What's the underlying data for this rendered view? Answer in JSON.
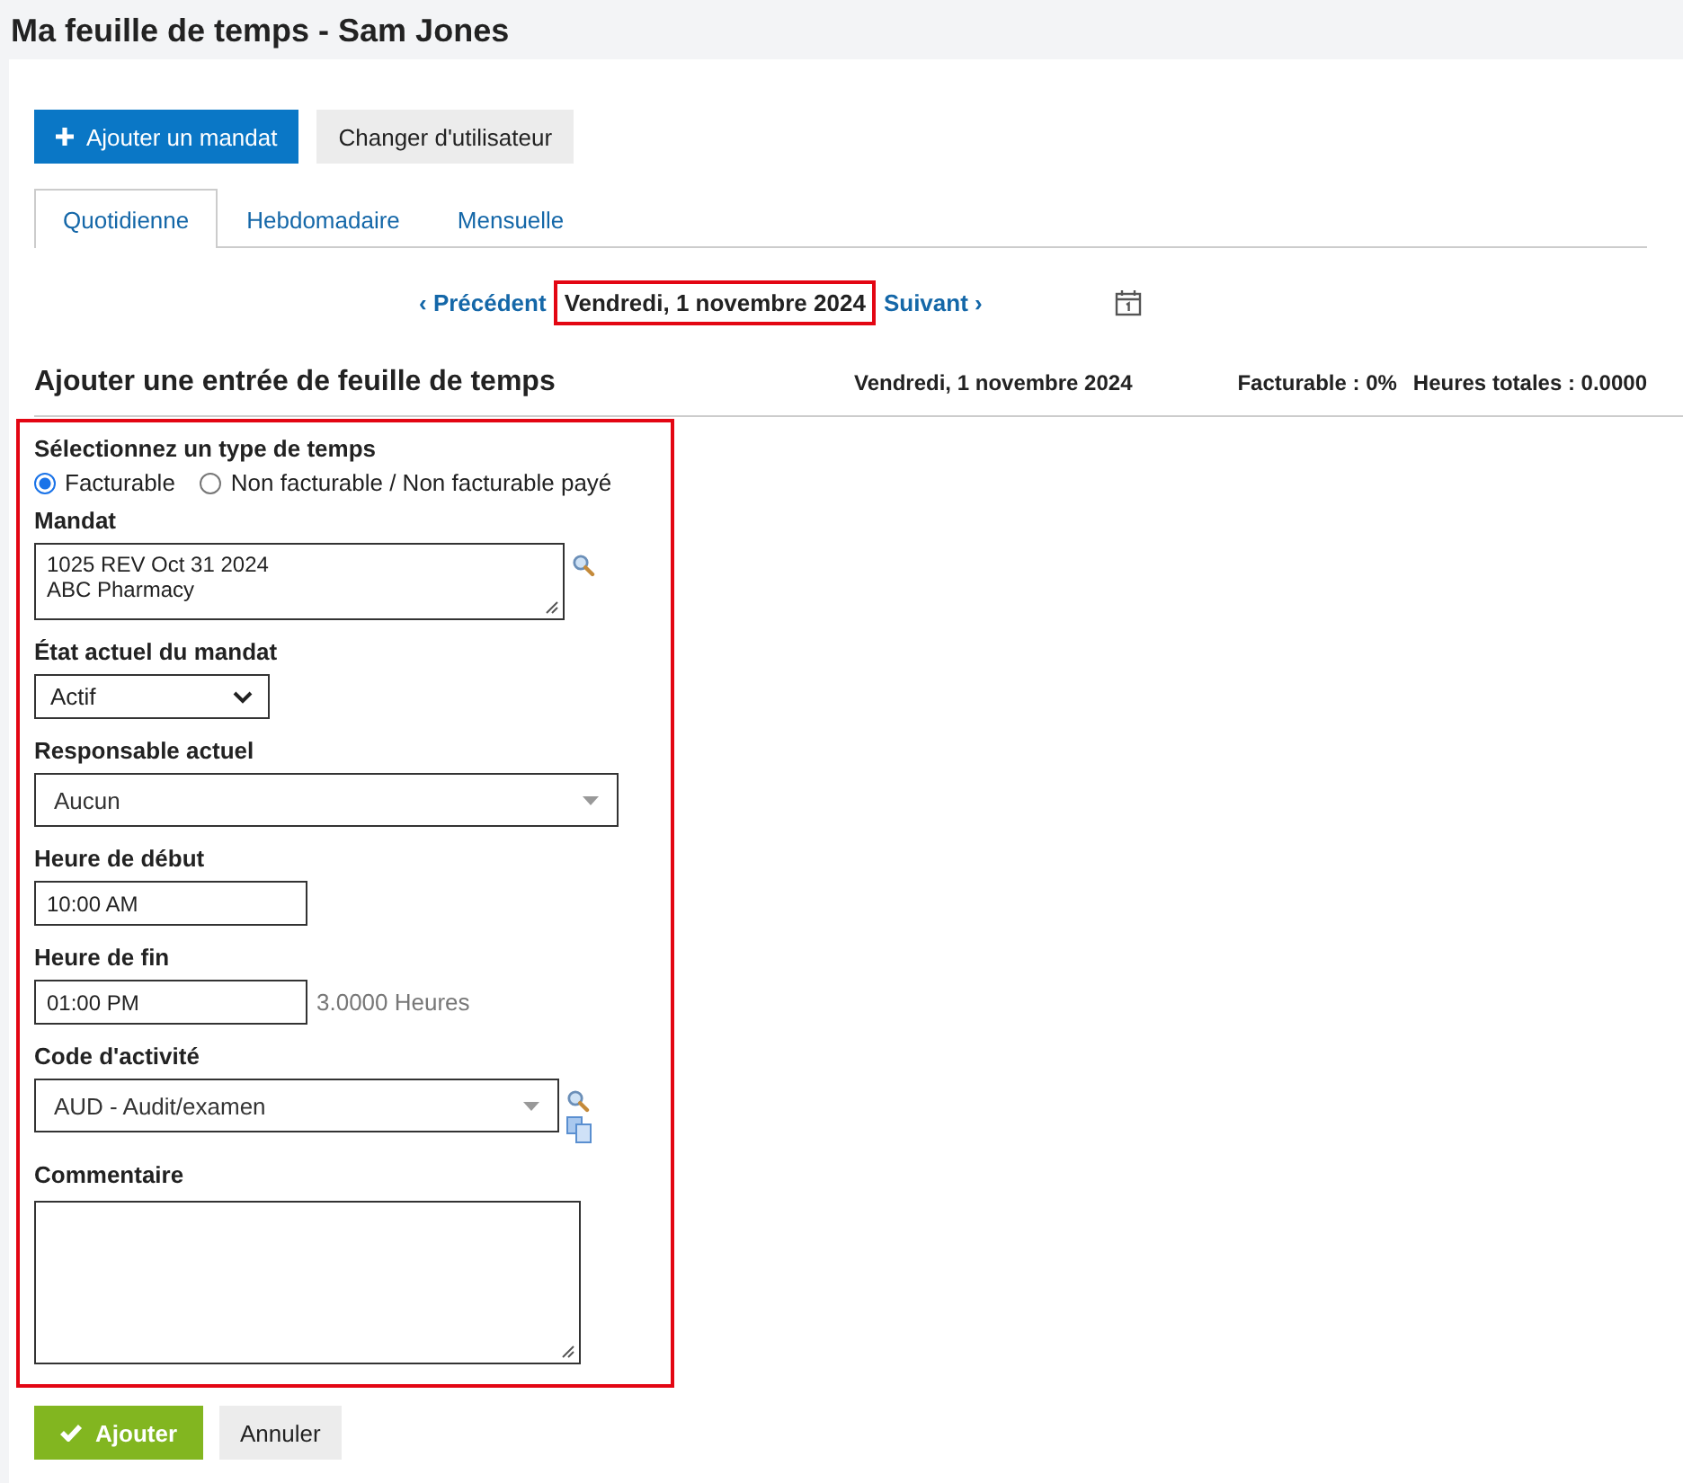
{
  "page_title": "Ma feuille de temps - Sam Jones",
  "toolbar": [
    {
      "kind": "primary",
      "label": "Ajouter un mandat"
    },
    {
      "kind": "secondary",
      "label": "Changer d'utilisateur"
    }
  ],
  "tabs": [
    {
      "label": "Quotidienne",
      "selected": true
    },
    {
      "label": "Hebdomadaire",
      "selected": false
    },
    {
      "label": "Mensuelle",
      "selected": false
    }
  ],
  "date_nav": {
    "previous": "‹ Précédent",
    "current": "Vendredi, 1 novembre 2024",
    "next": "Suivant ›"
  },
  "section": {
    "title": "Ajouter une entrée de feuille de temps",
    "date": "Vendredi, 1 novembre 2024",
    "billable": "Facturable : 0%",
    "total_hours": "Heures totales : 0.0000"
  },
  "time_type": {
    "label": "Sélectionnez un type de temps",
    "options": [
      {
        "label": "Facturable",
        "selected": true
      },
      {
        "label": "Non facturable / Non facturable payé",
        "selected": false
      }
    ]
  },
  "fields": [
    {
      "kind": "textarea",
      "label": "Mandat",
      "value": "1025 REV Oct 31 2024\nABC Pharmacy",
      "search_button": true
    },
    {
      "kind": "dropdown",
      "label": "État actuel du mandat",
      "value": "Actif"
    },
    {
      "kind": "combo",
      "label": "Responsable actuel",
      "value": "Aucun"
    },
    {
      "kind": "input",
      "label": "Heure de début",
      "value": "10:00 AM"
    },
    {
      "kind": "input",
      "label": "Heure de fin",
      "value": "01:00 PM",
      "note": "3.0000 Heures"
    },
    {
      "kind": "combo",
      "label": "Code d'activité",
      "value": "AUD - Audit/examen",
      "search_button": true,
      "copy_button": true
    },
    {
      "kind": "comment",
      "label": "Commentaire"
    }
  ],
  "actions": [
    {
      "kind": "confirm",
      "label": "Ajouter"
    },
    {
      "kind": "secondary",
      "label": "Annuler"
    }
  ]
}
